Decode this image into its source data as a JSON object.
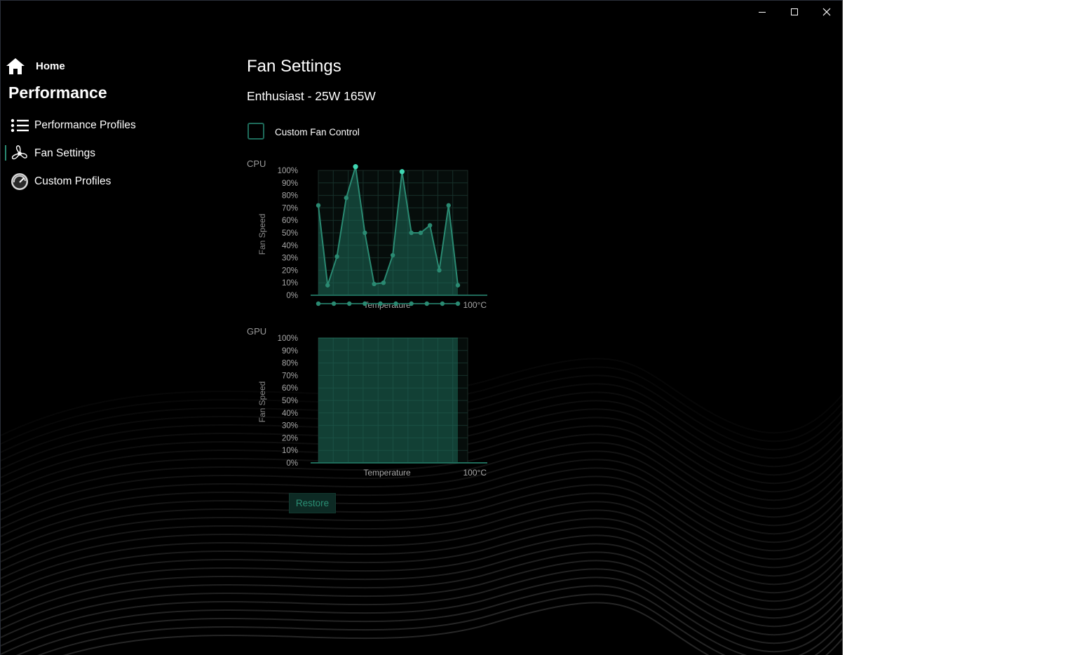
{
  "window": {
    "controls": {
      "minimize": "minimize-icon",
      "maximize": "maximize-icon",
      "close": "close-icon"
    }
  },
  "sidebar": {
    "home_label": "Home",
    "section_title": "Performance",
    "items": [
      {
        "label": "Performance Profiles",
        "icon": "list-icon"
      },
      {
        "label": "Fan Settings",
        "icon": "fan-icon",
        "selected": true
      },
      {
        "label": "Custom Profiles",
        "icon": "gauge-icon"
      }
    ]
  },
  "main": {
    "title": "Fan Settings",
    "subtitle": "Enthusiast - 25W 165W",
    "custom_fan_control": {
      "label": "Custom Fan Control",
      "checked": false
    },
    "restore_label": "Restore"
  },
  "colors": {
    "accent": "#2a9d82",
    "accent_bright": "#3fd6b2",
    "fill": "#1e6b5a",
    "background": "#000000"
  },
  "chart_data": [
    {
      "type": "line",
      "title": "CPU",
      "xlabel": "Temperature",
      "ylabel": "Fan Speed",
      "x_end_label": "100°C",
      "y_ticks": [
        "100%",
        "90%",
        "80%",
        "70%",
        "60%",
        "50%",
        "40%",
        "30%",
        "20%",
        "10%",
        "0%"
      ],
      "ylim": [
        0,
        100
      ],
      "points": [
        72,
        8,
        31,
        78,
        103,
        50,
        9,
        10,
        32,
        99,
        50,
        50,
        56,
        20,
        72,
        8
      ],
      "highlighted_points": [
        4,
        9
      ],
      "temperature_handles": 10,
      "grid": true
    },
    {
      "type": "area",
      "title": "GPU",
      "xlabel": "Temperature",
      "ylabel": "Fan Speed",
      "x_end_label": "100°C",
      "y_ticks": [
        "100%",
        "90%",
        "80%",
        "70%",
        "60%",
        "50%",
        "40%",
        "30%",
        "20%",
        "10%",
        "0%"
      ],
      "ylim": [
        0,
        100
      ],
      "points": [
        100,
        100
      ],
      "grid": true
    }
  ]
}
